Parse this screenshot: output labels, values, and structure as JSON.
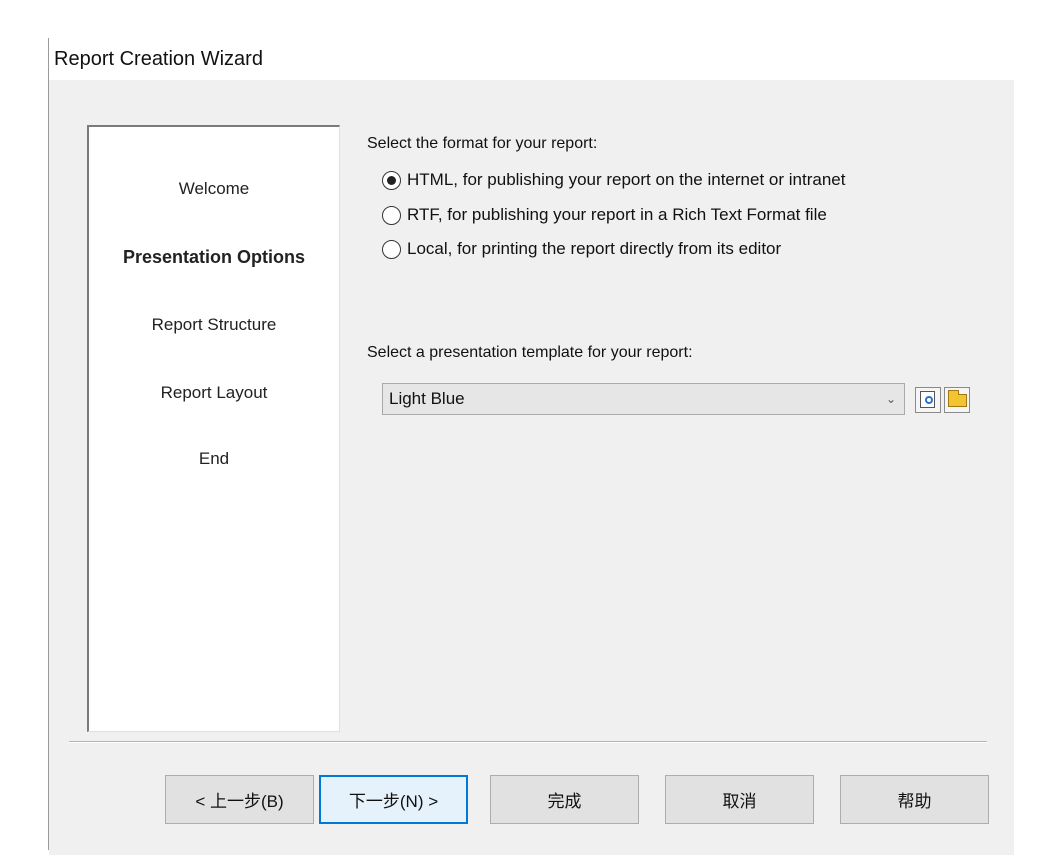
{
  "window": {
    "title": "Report Creation Wizard"
  },
  "steps": [
    "Welcome",
    "Presentation Options",
    "Report Structure",
    "Report Layout",
    "End"
  ],
  "active_step": "Presentation Options",
  "format": {
    "prompt": "Select the format for your report:",
    "options": [
      {
        "label": "HTML, for publishing your report on the internet or intranet",
        "checked": true
      },
      {
        "label": "RTF, for publishing your report in a Rich Text Format file",
        "checked": false
      },
      {
        "label": "Local, for printing the report directly from its editor",
        "checked": false
      }
    ]
  },
  "template": {
    "prompt": "Select a presentation template for your report:",
    "selected": "Light Blue"
  },
  "buttons": {
    "back": "< 上一步(B)",
    "next": "下一步(N) >",
    "finish": "完成",
    "cancel": "取消",
    "help": "帮助"
  },
  "icons": {
    "preview": "preview-icon",
    "folder": "folder-icon",
    "dropdown": "chevron-down-icon"
  }
}
